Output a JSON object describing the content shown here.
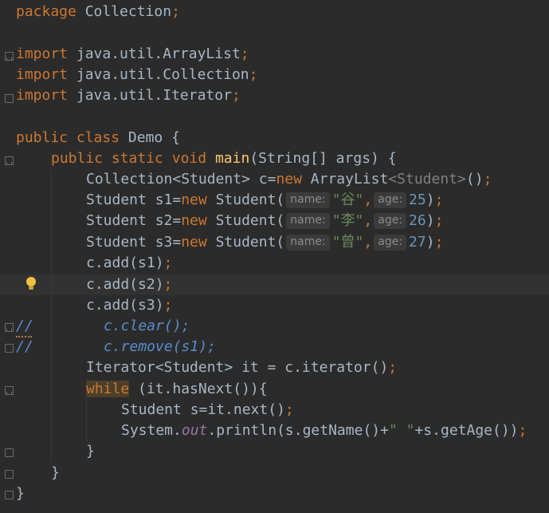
{
  "editor": {
    "lines": {
      "l1_kw": "package",
      "l1_name": "Collection",
      "l2_kw": "import",
      "l2_name": "java.util.ArrayList",
      "l3_kw": "import",
      "l3_name": "java.util.Collection",
      "l4_kw": "import",
      "l4_name": "java.util.Iterator",
      "class_public": "public",
      "class_kw": "class",
      "class_name": "Demo {",
      "main_public": "public",
      "main_static": "static",
      "main_void": "void",
      "main_name": "main",
      "main_args": "(String[] args) {",
      "coll_type": "Collection",
      "coll_gen": "<Student>",
      "coll_var": " c=",
      "coll_new": "new",
      "coll_arraylist": " ArrayList",
      "coll_gen2": "<Student>",
      "coll_end": "()",
      "s1_decl": "Student s1=",
      "s1_new": "new",
      "s1_ctor": " Student(",
      "s1_hint_name": "name:",
      "s1_name": "\"谷\"",
      "s1_hint_age": "age:",
      "s1_age": "25",
      "s1_end": ")",
      "s2_decl": "Student s2=",
      "s2_new": "new",
      "s2_ctor": " Student(",
      "s2_hint_name": "name:",
      "s2_name": "\"李\"",
      "s2_hint_age": "age:",
      "s2_age": "26",
      "s2_end": ")",
      "s3_decl": "Student s3=",
      "s3_new": "new",
      "s3_ctor": " Student(",
      "s3_hint_name": "name:",
      "s3_name": "\"曾\"",
      "s3_hint_age": "age:",
      "s3_age": "27",
      "s3_end": ")",
      "add1": "c.add(s1)",
      "add2": "c.add(s2)",
      "add3": "c.add(s3)",
      "cmt1_mark": "//",
      "cmt1_code": "c.clear();",
      "cmt2_mark": "//",
      "cmt2_code": "c.remove(s1);",
      "iter_decl": "Iterator<Student> it = c.iterator()",
      "while_kw": "while",
      "while_cond": " (it.hasNext()){",
      "next_decl": "Student s=it.next()",
      "print_sys": "System.",
      "print_out": "out",
      "print_call": ".println(s.getName()+",
      "print_str": "\" \"",
      "print_rest": "+s.getAge())",
      "close_while": "}",
      "close_main": "}",
      "close_class": "}",
      "semicolon": ";",
      "comma": ","
    }
  },
  "colors": {
    "background": "#2b2b2b",
    "keyword": "#cc7832",
    "default": "#a9b7c6",
    "method": "#ffc66d",
    "number": "#6897bb",
    "string": "#6a8759"
  },
  "icons": [
    "fold-icon",
    "lightbulb-icon"
  ]
}
